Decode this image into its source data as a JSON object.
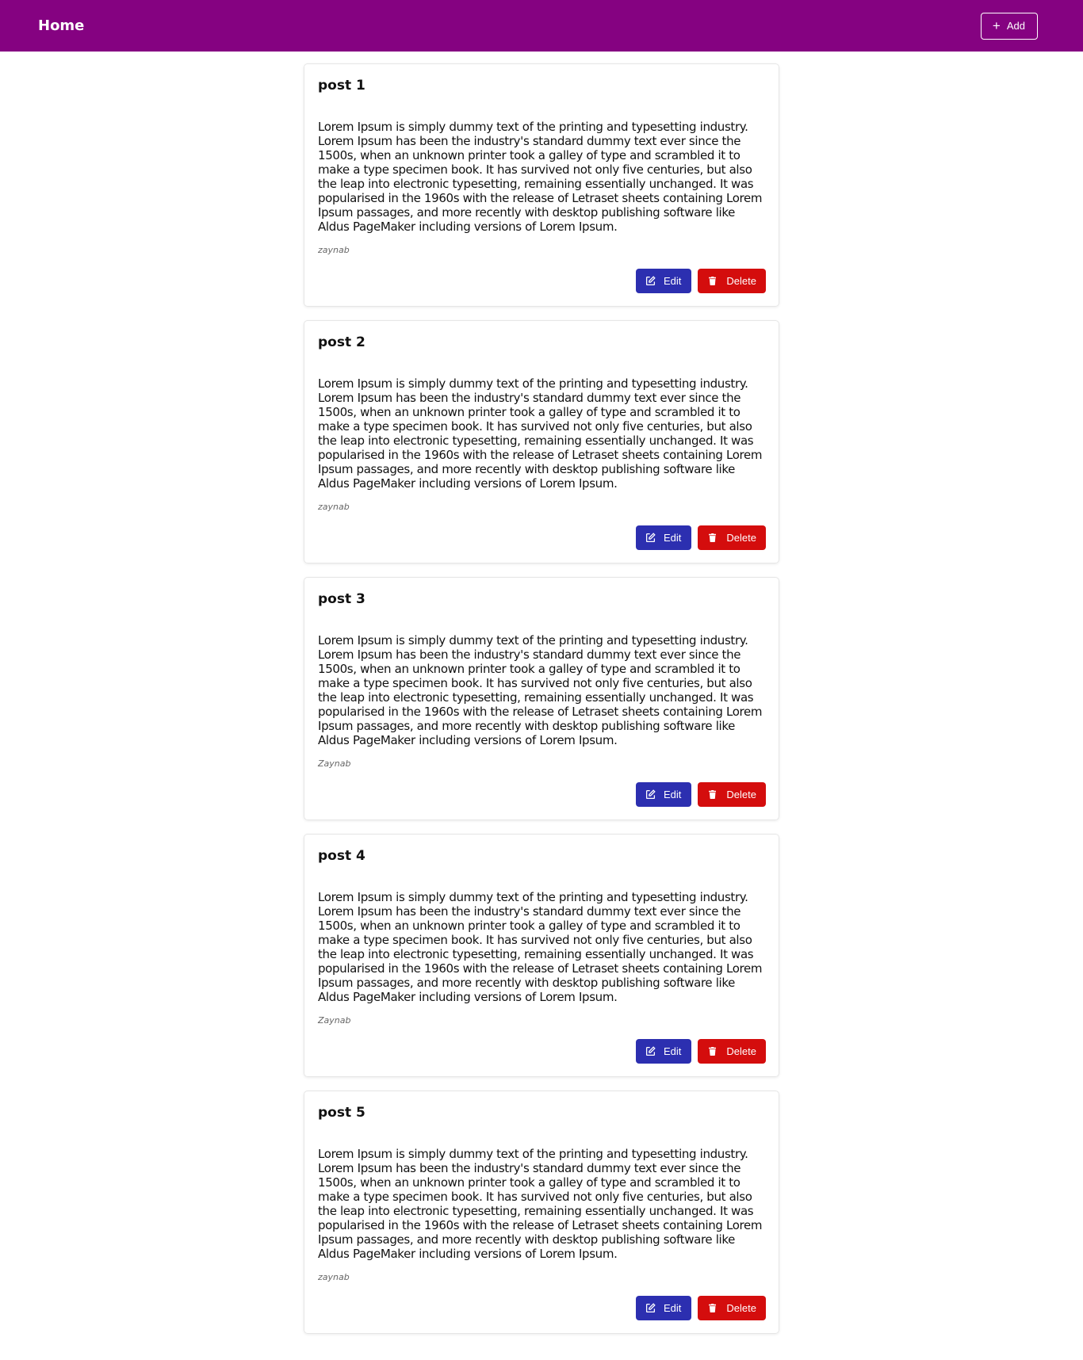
{
  "header": {
    "brand": "Home",
    "add_label": "Add",
    "add_icon": "plus-icon",
    "bg_color": "#850281"
  },
  "colors": {
    "edit": "#2c2fb0",
    "delete": "#d40d0d"
  },
  "posts": [
    {
      "title": "post 1",
      "body": "Lorem Ipsum is simply dummy text of the printing and typesetting industry. Lorem Ipsum has been the industry's standard dummy text ever since the 1500s, when an unknown printer took a galley of type and scrambled it to make a type specimen book. It has survived not only five centuries, but also the leap into electronic typesetting, remaining essentially unchanged. It was popularised in the 1960s with the release of Letraset sheets containing Lorem Ipsum passages, and more recently with desktop publishing software like Aldus PageMaker including versions of Lorem Ipsum.",
      "author": "zaynab",
      "edit_label": "Edit",
      "delete_label": "Delete"
    },
    {
      "title": "post 2",
      "body": "Lorem Ipsum is simply dummy text of the printing and typesetting industry. Lorem Ipsum has been the industry's standard dummy text ever since the 1500s, when an unknown printer took a galley of type and scrambled it to make a type specimen book. It has survived not only five centuries, but also the leap into electronic typesetting, remaining essentially unchanged. It was popularised in the 1960s with the release of Letraset sheets containing Lorem Ipsum passages, and more recently with desktop publishing software like Aldus PageMaker including versions of Lorem Ipsum.",
      "author": "zaynab",
      "edit_label": "Edit",
      "delete_label": "Delete"
    },
    {
      "title": "post 3",
      "body": "Lorem Ipsum is simply dummy text of the printing and typesetting industry. Lorem Ipsum has been the industry's standard dummy text ever since the 1500s, when an unknown printer took a galley of type and scrambled it to make a type specimen book. It has survived not only five centuries, but also the leap into electronic typesetting, remaining essentially unchanged. It was popularised in the 1960s with the release of Letraset sheets containing Lorem Ipsum passages, and more recently with desktop publishing software like Aldus PageMaker including versions of Lorem Ipsum.",
      "author": "Zaynab",
      "edit_label": "Edit",
      "delete_label": "Delete"
    },
    {
      "title": "post 4",
      "body": "Lorem Ipsum is simply dummy text of the printing and typesetting industry. Lorem Ipsum has been the industry's standard dummy text ever since the 1500s, when an unknown printer took a galley of type and scrambled it to make a type specimen book. It has survived not only five centuries, but also the leap into electronic typesetting, remaining essentially unchanged. It was popularised in the 1960s with the release of Letraset sheets containing Lorem Ipsum passages, and more recently with desktop publishing software like Aldus PageMaker including versions of Lorem Ipsum.",
      "author": "Zaynab",
      "edit_label": "Edit",
      "delete_label": "Delete"
    },
    {
      "title": "post 5",
      "body": "Lorem Ipsum is simply dummy text of the printing and typesetting industry. Lorem Ipsum has been the industry's standard dummy text ever since the 1500s, when an unknown printer took a galley of type and scrambled it to make a type specimen book. It has survived not only five centuries, but also the leap into electronic typesetting, remaining essentially unchanged. It was popularised in the 1960s with the release of Letraset sheets containing Lorem Ipsum passages, and more recently with desktop publishing software like Aldus PageMaker including versions of Lorem Ipsum.",
      "author": "zaynab",
      "edit_label": "Edit",
      "delete_label": "Delete"
    }
  ]
}
